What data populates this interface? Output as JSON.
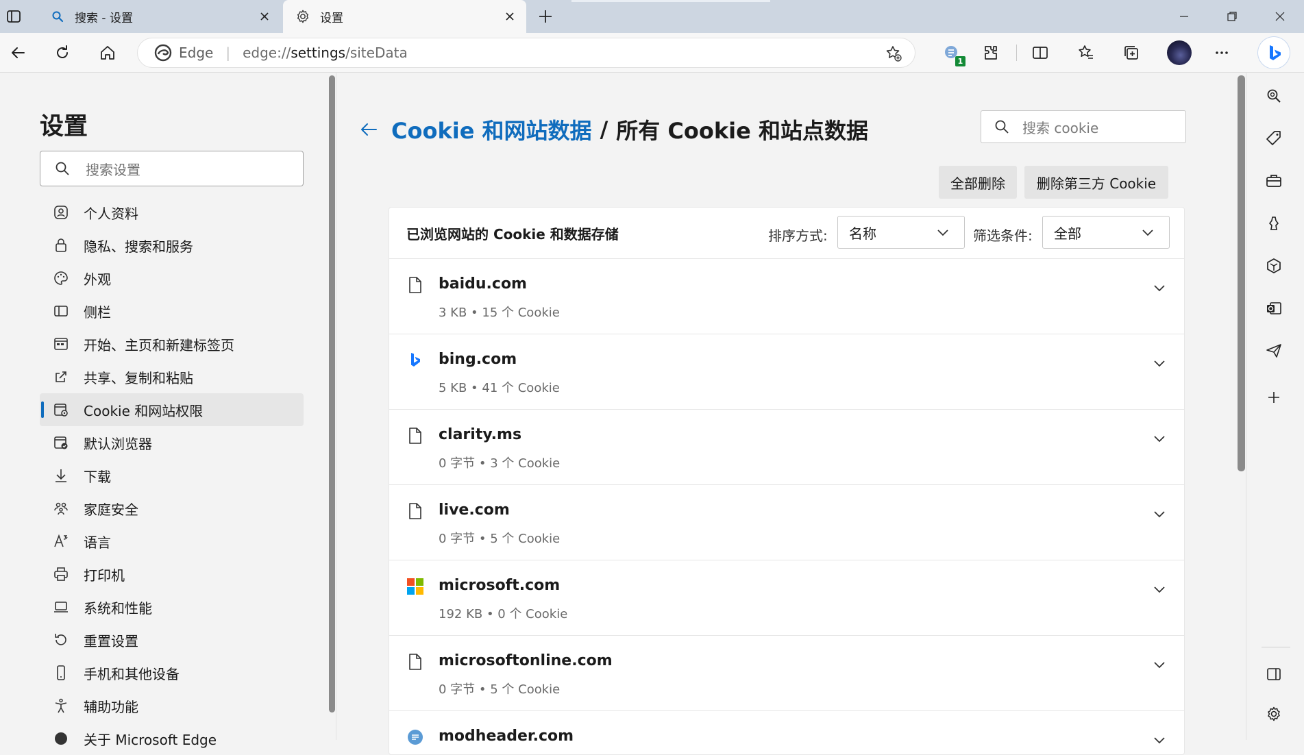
{
  "tabs": [
    {
      "title": "搜索 - 设置",
      "favicon": "search-icon",
      "active": false
    },
    {
      "title": "设置",
      "favicon": "gear-icon",
      "active": true
    }
  ],
  "toolbar": {
    "address_brand": "Edge",
    "address_scheme": "edge://",
    "address_path_bold": "settings",
    "address_path_rest": "/siteData",
    "extension_badge": "1"
  },
  "nav": {
    "title": "设置",
    "search_placeholder": "搜索设置",
    "items": [
      {
        "label": "个人资料",
        "icon": "profile-icon"
      },
      {
        "label": "隐私、搜索和服务",
        "icon": "lock-icon"
      },
      {
        "label": "外观",
        "icon": "palette-icon"
      },
      {
        "label": "侧栏",
        "icon": "sidebar-icon"
      },
      {
        "label": "开始、主页和新建标签页",
        "icon": "home-page-icon"
      },
      {
        "label": "共享、复制和粘贴",
        "icon": "share-icon"
      },
      {
        "label": "Cookie 和网站权限",
        "icon": "cookie-permissions-icon",
        "selected": true
      },
      {
        "label": "默认浏览器",
        "icon": "default-browser-icon"
      },
      {
        "label": "下载",
        "icon": "download-icon"
      },
      {
        "label": "家庭安全",
        "icon": "family-icon"
      },
      {
        "label": "语言",
        "icon": "language-icon"
      },
      {
        "label": "打印机",
        "icon": "printer-icon"
      },
      {
        "label": "系统和性能",
        "icon": "laptop-icon"
      },
      {
        "label": "重置设置",
        "icon": "reset-icon"
      },
      {
        "label": "手机和其他设备",
        "icon": "phone-icon"
      },
      {
        "label": "辅助功能",
        "icon": "accessibility-icon"
      },
      {
        "label": "关于 Microsoft Edge",
        "icon": "edge-icon"
      }
    ]
  },
  "main": {
    "breadcrumb_link": "Cookie 和网站数据",
    "breadcrumb_sep": "/",
    "breadcrumb_current": "所有 Cookie 和站点数据",
    "search_placeholder": "搜索 cookie",
    "delete_all": "全部删除",
    "delete_third_party": "删除第三方 Cookie",
    "card_title": "已浏览网站的 Cookie 和数据存储",
    "sort_label": "排序方式:",
    "sort_value": "名称",
    "filter_label": "筛选条件:",
    "filter_value": "全部",
    "sites": [
      {
        "domain": "baidu.com",
        "meta": "3 KB • 15 个 Cookie",
        "favicon": "document-icon"
      },
      {
        "domain": "bing.com",
        "meta": "5 KB • 41 个 Cookie",
        "favicon": "bing-icon"
      },
      {
        "domain": "clarity.ms",
        "meta": "0 字节 • 3 个 Cookie",
        "favicon": "document-icon"
      },
      {
        "domain": "live.com",
        "meta": "0 字节 • 5 个 Cookie",
        "favicon": "document-icon"
      },
      {
        "domain": "microsoft.com",
        "meta": "192 KB • 0 个 Cookie",
        "favicon": "microsoft-logo-icon"
      },
      {
        "domain": "microsoftonline.com",
        "meta": "0 字节 • 5 个 Cookie",
        "favicon": "document-icon"
      },
      {
        "domain": "modheader.com",
        "meta": "",
        "favicon": "modheader-icon"
      }
    ]
  },
  "colors": {
    "accent": "#0f6cbd",
    "tabstrip": "#cdd6e1",
    "selected_nav": "#e6e6e6"
  }
}
